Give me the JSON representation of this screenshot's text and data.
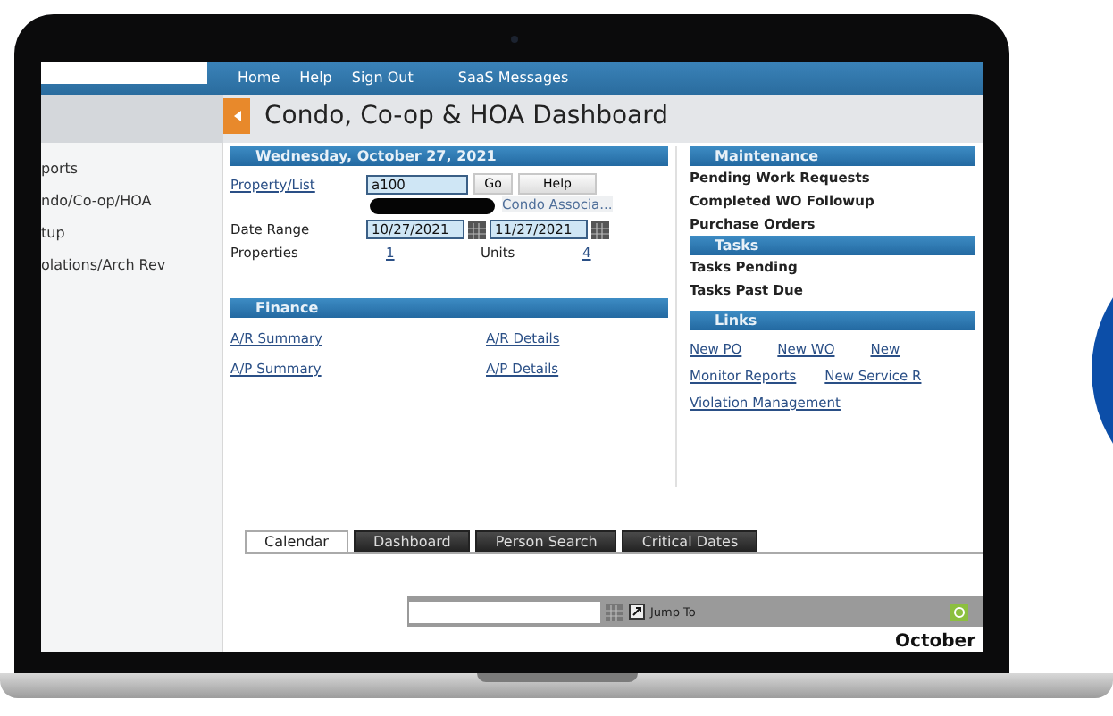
{
  "nav": {
    "links": [
      "Home",
      "Help",
      "Sign Out",
      "SaaS Messages"
    ]
  },
  "header": {
    "title": "Condo, Co-op & HOA Dashboard"
  },
  "sidebar": {
    "items": [
      "ports",
      "ndo/Co-op/HOA",
      "tup",
      "olations/Arch Rev"
    ]
  },
  "overview": {
    "date_heading": "Wednesday, October 27, 2021",
    "property_link": "Property/List",
    "property_value": "a100",
    "go_button": "Go",
    "help_button": "Help",
    "association": "Condo Associa...",
    "date_range_label": "Date Range",
    "date_from": "10/27/2021",
    "date_to": "11/27/2021",
    "properties_label": "Properties",
    "properties_count": "1",
    "units_label": "Units",
    "units_count": "4"
  },
  "finance": {
    "heading": "Finance",
    "links": [
      "A/R Summary",
      "A/R Details",
      "A/P Summary",
      "A/P Details"
    ]
  },
  "maintenance": {
    "heading": "Maintenance",
    "items": [
      "Pending Work Requests",
      "Completed WO Followup",
      "Purchase Orders"
    ]
  },
  "tasks": {
    "heading": "Tasks",
    "items": [
      "Tasks Pending",
      "Tasks Past Due"
    ]
  },
  "links": {
    "heading": "Links",
    "rows": [
      [
        "New PO",
        "New WO",
        "New"
      ],
      [
        "Monitor Reports",
        "New Service R"
      ],
      [
        "Violation Management"
      ]
    ]
  },
  "tabs": [
    {
      "label": "Calendar",
      "selected": true
    },
    {
      "label": "Dashboard",
      "selected": false
    },
    {
      "label": "Person Search",
      "selected": false
    },
    {
      "label": "Critical Dates",
      "selected": false
    }
  ],
  "calendar": {
    "jump_label": "Jump To",
    "month": "October"
  }
}
